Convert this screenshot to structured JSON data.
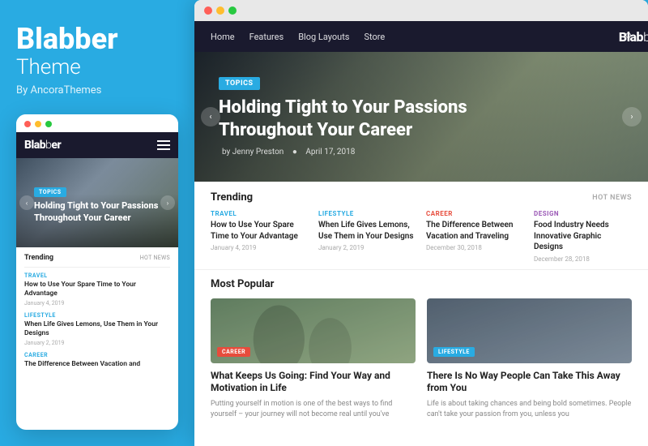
{
  "brand": {
    "name_bold": "Blabber",
    "name_light": "Theme",
    "by": "By AncoraThemes"
  },
  "mobile": {
    "logo": "Blab",
    "logo_bold": "b",
    "logo_rest": "er",
    "hero": {
      "badge": "TOPICS",
      "title": "Holding Tight to Your Passions Throughout Your Career"
    },
    "trending_label": "Trending",
    "hot_news": "HOT NEWS",
    "articles": [
      {
        "cat": "TRAVEL",
        "title": "How to Use Your Spare Time to Your Advantage",
        "date": "January 4, 2019"
      },
      {
        "cat": "LIFESTYLE",
        "title": "When Life Gives Lemons, Use Them in Your Designs",
        "date": "January 2, 2019"
      },
      {
        "cat": "CAREER",
        "title": "The Difference Between Vacation and",
        "date": ""
      }
    ]
  },
  "desktop": {
    "nav": {
      "links": [
        "Home",
        "Features",
        "Blog Layouts",
        "Store"
      ],
      "logo": "Blabber"
    },
    "hero": {
      "badge": "TOPICS",
      "title": "Holding Tight to Your Passions Throughout Your Career",
      "author": "by Jenny Preston",
      "date": "April 17, 2018"
    },
    "trending": {
      "label": "Trending",
      "hot_news": "HOT NEWS",
      "items": [
        {
          "cat": "TRAVEL",
          "cat_class": "travel",
          "title": "How to Use Your Spare Time to Your Advantage",
          "date": "January 4, 2019"
        },
        {
          "cat": "LIFESTYLE",
          "cat_class": "lifestyle",
          "title": "When Life Gives Lemons, Use Them in Your Designs",
          "date": "January 2, 2019"
        },
        {
          "cat": "CAREER",
          "cat_class": "career",
          "title": "The Difference Between Vacation and Traveling",
          "date": "December 30, 2018"
        },
        {
          "cat": "DESIGN",
          "cat_class": "design",
          "title": "Food Industry Needs Innovative Graphic Designs",
          "date": "December 28, 2018"
        }
      ]
    },
    "popular": {
      "label": "Most Popular",
      "cards": [
        {
          "badge": "CAREER",
          "badge_class": "card-badge-career",
          "title": "What Keeps Us Going: Find Your Way and Motivation in Life",
          "text": "Putting yourself in motion is one of the best ways to find yourself – your journey will not become real until you've",
          "img_color1": "#7a9a7a",
          "img_color2": "#5a8a6a"
        },
        {
          "badge": "LIFESTYLE",
          "badge_class": "card-badge-lifestyle",
          "title": "There Is No Way People Can Take This Away from You",
          "text": "Life is about taking chances and being bold sometimes. People can't take your passion from you, unless you",
          "img_color1": "#6a7a8a",
          "img_color2": "#8a9aaa"
        }
      ]
    }
  }
}
